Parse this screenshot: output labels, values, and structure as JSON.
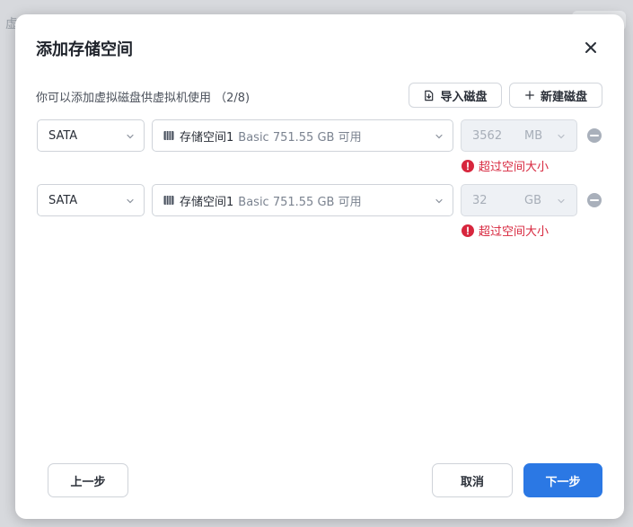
{
  "background": {
    "partial_text": "虚"
  },
  "dialog": {
    "title": "添加存储空间",
    "subtitle": "你可以添加虚拟磁盘供虚拟机使用 （2/8)",
    "import_label": "导入磁盘",
    "new_label": "新建磁盘"
  },
  "disks": [
    {
      "type": "SATA",
      "space_name": "存储空间1",
      "space_detail": "Basic  751.55 GB 可用",
      "size_value": "3562",
      "size_unit": "MB",
      "error": "超过空间大小"
    },
    {
      "type": "SATA",
      "space_name": "存储空间1",
      "space_detail": "Basic  751.55 GB 可用",
      "size_value": "32",
      "size_unit": "GB",
      "error": "超过空间大小"
    }
  ],
  "footer": {
    "prev_label": "上一步",
    "cancel_label": "取消",
    "next_label": "下一步"
  },
  "colors": {
    "primary": "#2b78e4",
    "error": "#d7263d",
    "disabled_bg": "#eef1f5"
  }
}
